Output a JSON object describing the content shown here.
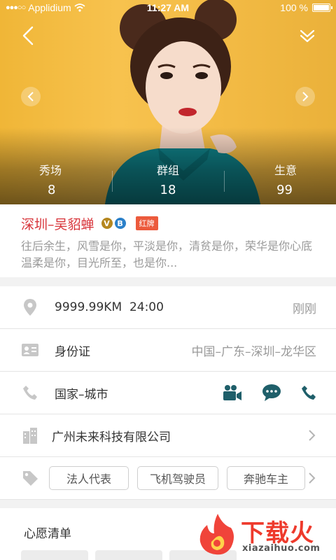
{
  "status_bar": {
    "carrier": "Applidium",
    "time": "11:27 AM",
    "battery": "100 %"
  },
  "hero": {
    "stats": [
      {
        "label": "秀场",
        "value": "8"
      },
      {
        "label": "群组",
        "value": "18"
      },
      {
        "label": "生意",
        "value": "99"
      }
    ]
  },
  "profile": {
    "name": "深圳–吴貂蝉",
    "badge_v": "V",
    "badge_b": "B",
    "tag": "红牌",
    "bio": "往后余生，风雪是你，平淡是你，清贫是你，荣华是你心底温柔是你，目光所至，也是你..."
  },
  "info": {
    "location_distance": "9999.99KM",
    "location_time": "24:00",
    "location_status": "刚刚",
    "id_label": "身份证",
    "id_region": "中国–广东–深圳–龙华区",
    "contact_label": "国家–城市",
    "company": "广州未来科技有限公司",
    "tags": [
      "法人代表",
      "飞机驾驶员",
      "奔驰车主"
    ]
  },
  "wishlist": {
    "title": "心愿清单"
  },
  "watermark": {
    "text": "下载火",
    "sub": "xiazaihuo.com"
  },
  "colors": {
    "accent_red": "#d8353b",
    "icon_teal": "#1f5f6a",
    "hero_yellow": "#f7c24e"
  }
}
